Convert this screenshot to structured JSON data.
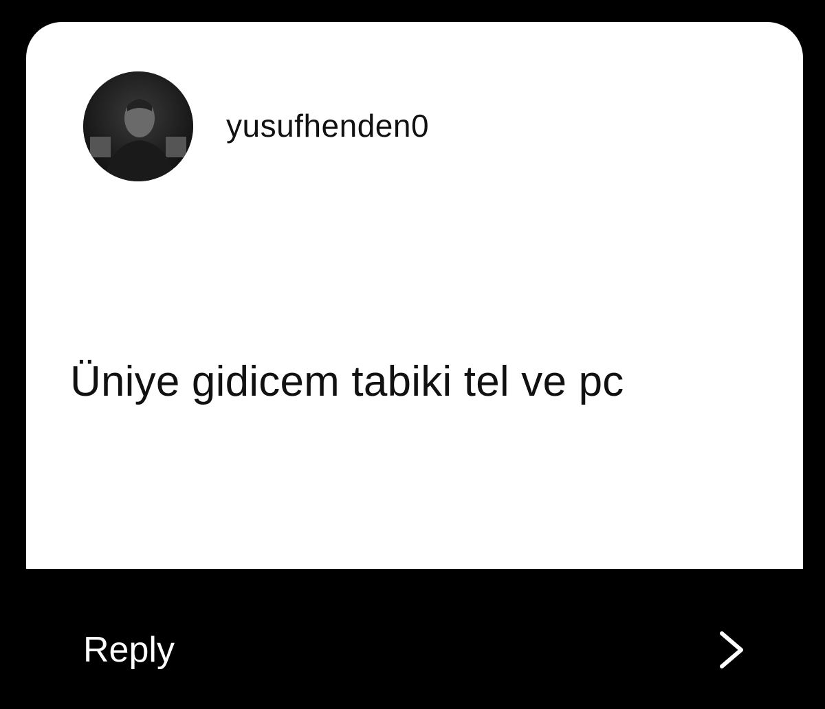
{
  "story_reply": {
    "username": "yusufhenden0",
    "avatar_icon": "profile-photo",
    "message": "Üniye gidicem tabiki tel ve pc"
  },
  "footer": {
    "reply_label": "Reply",
    "forward_icon": "chevron-right-icon"
  },
  "colors": {
    "background": "#000000",
    "card": "#ffffff",
    "text_dark": "#111111",
    "text_light": "#ffffff"
  }
}
